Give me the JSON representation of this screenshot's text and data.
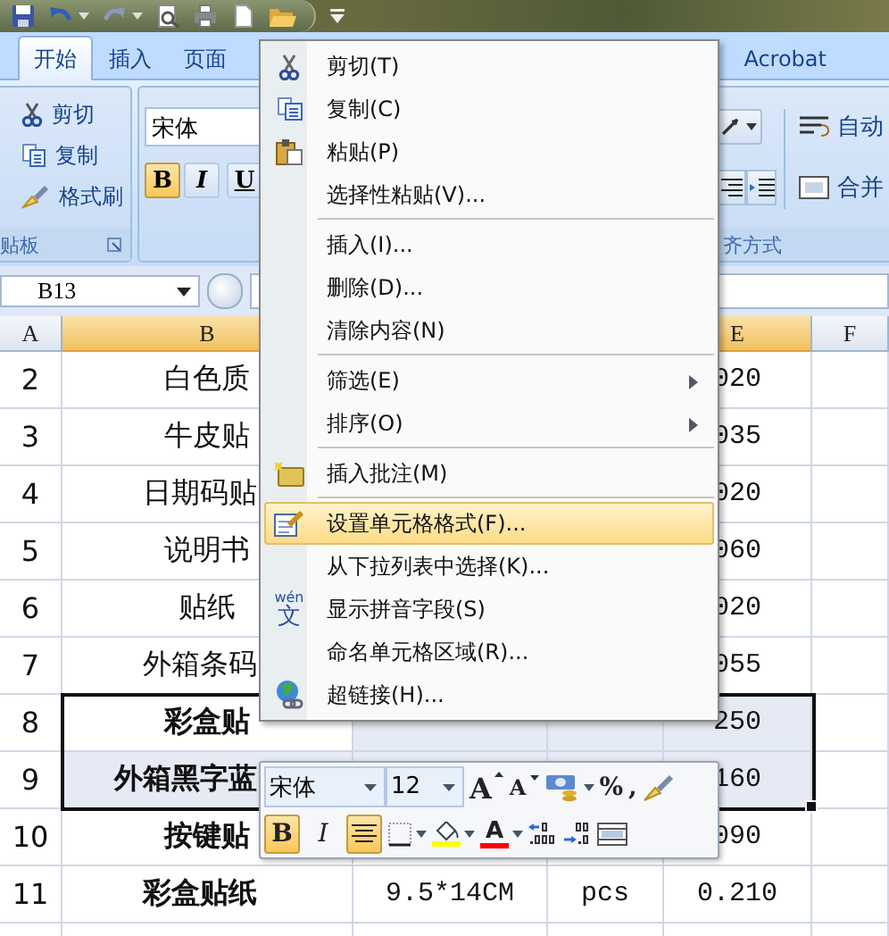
{
  "tabs": [
    {
      "label": "开始",
      "selected": true
    },
    {
      "label": "插入",
      "selected": false
    },
    {
      "label": "页面",
      "selected": false
    },
    {
      "label": "Acrobat",
      "selected": false
    }
  ],
  "clipboard": {
    "commands": [
      "剪切",
      "复制",
      "格式刷"
    ],
    "group_label": "贴板"
  },
  "font_group": {
    "font": "宋体",
    "buttons": [
      {
        "glyph": "B",
        "on": true
      },
      {
        "glyph": "I",
        "on": false
      },
      {
        "glyph": "U",
        "on": false
      }
    ]
  },
  "alignment_group": {
    "commands": [
      "自动",
      "合并"
    ],
    "group_label": "齐方式"
  },
  "name_box": "B13",
  "column_headers": {
    "a": {
      "label": "A",
      "selected": false
    },
    "b": {
      "label": "B",
      "selected": true
    },
    "e": {
      "label": "E",
      "selected": true
    },
    "f": {
      "label": "F",
      "selected": false
    }
  },
  "rows": [
    {
      "a": "2",
      "b": "白色质",
      "e": "020",
      "bold": false,
      "selected": false
    },
    {
      "a": "3",
      "b": "牛皮贴",
      "e": "035",
      "bold": false,
      "selected": false
    },
    {
      "a": "4",
      "b": "日期码贴",
      "e": "020",
      "bold": false,
      "selected": false
    },
    {
      "a": "5",
      "b": "说明书",
      "e": "060",
      "bold": false,
      "selected": false
    },
    {
      "a": "6",
      "b": "贴纸",
      "e": "020",
      "bold": false,
      "selected": false
    },
    {
      "a": "7",
      "b": "外箱条码",
      "e": "055",
      "bold": false,
      "selected": false
    },
    {
      "a": "8",
      "b": "彩盒贴",
      "e": "250",
      "bold": true,
      "selected": true
    },
    {
      "a": "9",
      "b": "外箱黑字蓝",
      "e": "160",
      "bold": true,
      "selected": true
    },
    {
      "a": "10",
      "b": "按键贴",
      "e": "090",
      "bold": true,
      "selected": false
    },
    {
      "a": "11",
      "b": "彩盒贴纸",
      "c": "9.5*14CM",
      "d": "pcs",
      "e": "0.210",
      "bold": true,
      "selected": false
    }
  ],
  "menu": {
    "items": [
      {
        "kind": "item",
        "label": "剪切(T)",
        "selected": false
      },
      {
        "kind": "item",
        "label": "复制(C)",
        "selected": false
      },
      {
        "kind": "item",
        "label": "粘贴(P)",
        "selected": false
      },
      {
        "kind": "item",
        "label": "选择性粘贴(V)...",
        "selected": false
      },
      {
        "kind": "separator"
      },
      {
        "kind": "item",
        "label": "插入(I)...",
        "selected": false
      },
      {
        "kind": "item",
        "label": "删除(D)...",
        "selected": false
      },
      {
        "kind": "item",
        "label": "清除内容(N)",
        "selected": false
      },
      {
        "kind": "separator"
      },
      {
        "kind": "submenu",
        "label": "筛选(E)",
        "selected": false
      },
      {
        "kind": "submenu",
        "label": "排序(O)",
        "selected": false
      },
      {
        "kind": "separator"
      },
      {
        "kind": "item",
        "label": "插入批注(M)",
        "selected": false
      },
      {
        "kind": "separator"
      },
      {
        "kind": "item",
        "label": "设置单元格格式(F)...",
        "selected": true
      },
      {
        "kind": "item",
        "label": "从下拉列表中选择(K)...",
        "selected": false
      },
      {
        "kind": "item",
        "label": "显示拼音字段(S)",
        "glyph_top": "wén",
        "glyph": "文",
        "selected": false
      },
      {
        "kind": "item",
        "label": "命名单元格区域(R)...",
        "selected": false
      },
      {
        "kind": "item",
        "label": "超链接(H)...",
        "selected": false
      }
    ]
  },
  "mini_toolbar": {
    "font": "宋体",
    "size": "12",
    "row1": [
      {
        "kind": "grow-font",
        "glyph": "A"
      },
      {
        "kind": "shrink-font",
        "glyph": "A"
      },
      {
        "kind": "accounting"
      },
      {
        "kind": "percent",
        "glyph": "%"
      },
      {
        "kind": "comma",
        "glyph": ","
      },
      {
        "kind": "format-painter"
      }
    ],
    "row2": [
      {
        "kind": "bold",
        "glyph": "B",
        "on": true
      },
      {
        "kind": "italic",
        "glyph": "I",
        "on": false
      },
      {
        "kind": "center",
        "on": true
      },
      {
        "kind": "borders"
      },
      {
        "kind": "fill-color",
        "color": "#ffff00"
      },
      {
        "kind": "font-color",
        "glyph": "A",
        "color": "#ff0000"
      },
      {
        "kind": "increase-decimal"
      },
      {
        "kind": "decrease-decimal"
      },
      {
        "kind": "merge"
      }
    ]
  }
}
